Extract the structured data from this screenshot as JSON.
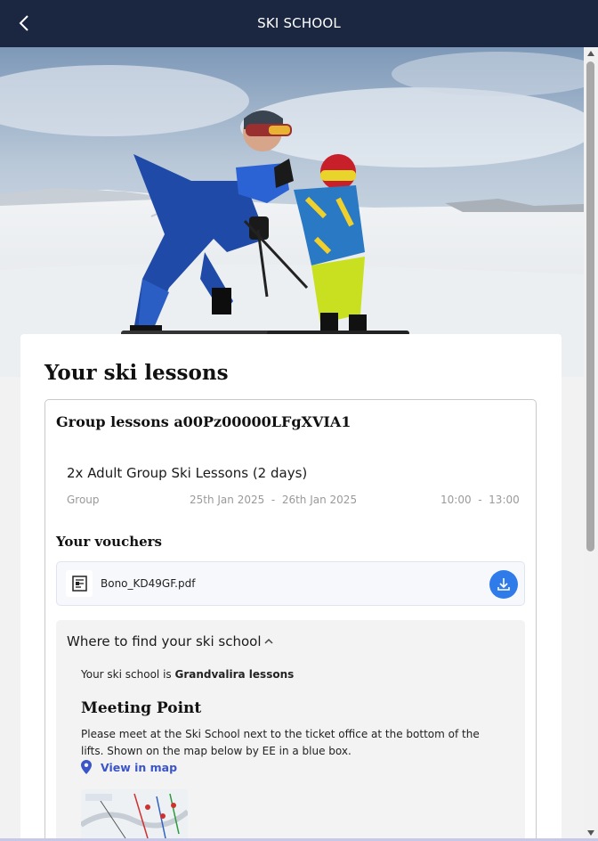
{
  "header": {
    "title": "SKI SCHOOL",
    "back_icon": "chevron-left-icon"
  },
  "hero": {
    "image": "ski-instructor-high-five-child-photo"
  },
  "main": {
    "title": "Your ski lessons",
    "lesson": {
      "title": "Group lessons a00Pz00000LFgXVIA1",
      "course_name": "2x Adult Group Ski Lessons (2 days)",
      "type": "Group",
      "date_range": "25th Jan 2025  -  26th Jan 2025",
      "time_range": "10:00  -  13:00"
    },
    "vouchers": {
      "title": "Your vouchers",
      "items": [
        {
          "file_name": "Bono_KD49GF.pdf",
          "icon": "document-icon",
          "action_icon": "download-icon"
        }
      ]
    },
    "where_to_find": {
      "header": "Where to find your ski school",
      "expanded_icon": "chevron-up-icon",
      "school_prefix": "Your ski school is ",
      "school_name": "Grandvalira lessons",
      "meeting_title": "Meeting Point",
      "meeting_text": "Please meet at the Ski School next to the ticket office at the bottom of the lifts. Shown on the map below by EE in a blue box.",
      "map_link": "View in map",
      "map_link_icon": "location-pin-icon"
    }
  },
  "colors": {
    "topbar": "#1b2640",
    "accent_blue": "#2f7bea",
    "link": "#3a55c9"
  }
}
